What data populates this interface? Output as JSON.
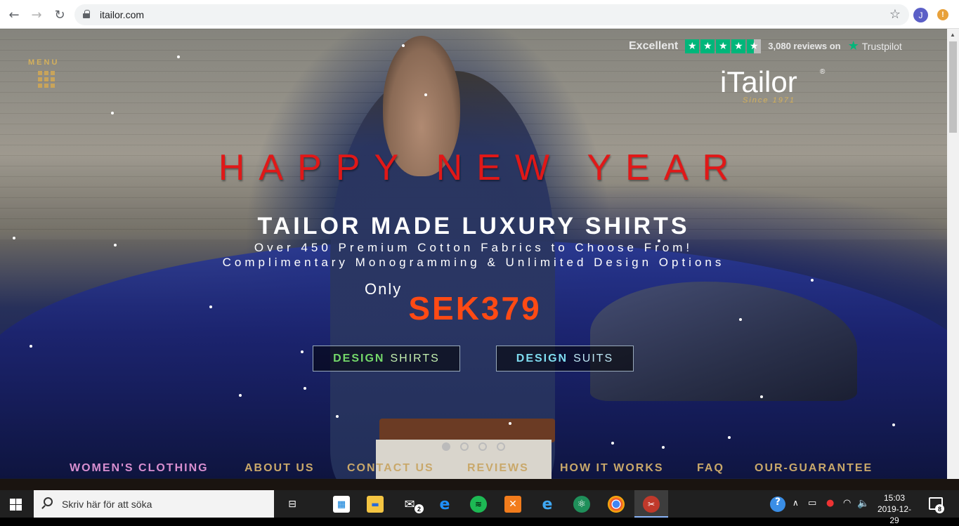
{
  "browser": {
    "url": "itailor.com",
    "profile_initial": "J",
    "alert_glyph": "!"
  },
  "site": {
    "menu_label": "MENU",
    "trustpilot": {
      "rating_word": "Excellent",
      "stars": 4.5,
      "reviews": "3,080 reviews on",
      "brand": "Trustpilot"
    },
    "brand": {
      "name": "iTailor",
      "registered": "®",
      "since": "Since 1971"
    },
    "hero": {
      "greeting": "HAPPY NEW YEAR",
      "headline": "TAILOR MADE LUXURY SHIRTS",
      "line1": "Over 450 Premium Cotton Fabrics to Choose From!",
      "line2": "Complimentary Monogramming & Unlimited Design Options",
      "only": "Only",
      "price": "SEK379"
    },
    "buttons": {
      "shirts_strong": "DESIGN",
      "shirts_rest": "SHIRTS",
      "suits_strong": "DESIGN",
      "suits_rest": "SUITS"
    },
    "carousel": {
      "slides": 4,
      "active": 1
    },
    "nav": [
      "WOMEN'S CLOTHING",
      "ABOUT US",
      "CONTACT US",
      "REVIEWS",
      "HOW IT WORKS",
      "FAQ",
      "OUR-GUARANTEE"
    ]
  },
  "colors": {
    "greeting": "#e01818",
    "price": "#ff4a14",
    "gold": "#c9a86a",
    "trustpilot_green": "#00b67a"
  },
  "taskbar": {
    "search_placeholder": "Skriv här för att söka",
    "mail_badge": "2",
    "time": "15:03",
    "date": "2019-12-29",
    "notifications": "8",
    "icons": [
      "task-view-icon",
      "store-icon",
      "file-explorer-icon",
      "mail-icon",
      "edge-icon",
      "spotify-icon",
      "xampp-icon",
      "internet-explorer-icon",
      "atom-icon",
      "chrome-icon",
      "snipping-tool-icon"
    ]
  }
}
